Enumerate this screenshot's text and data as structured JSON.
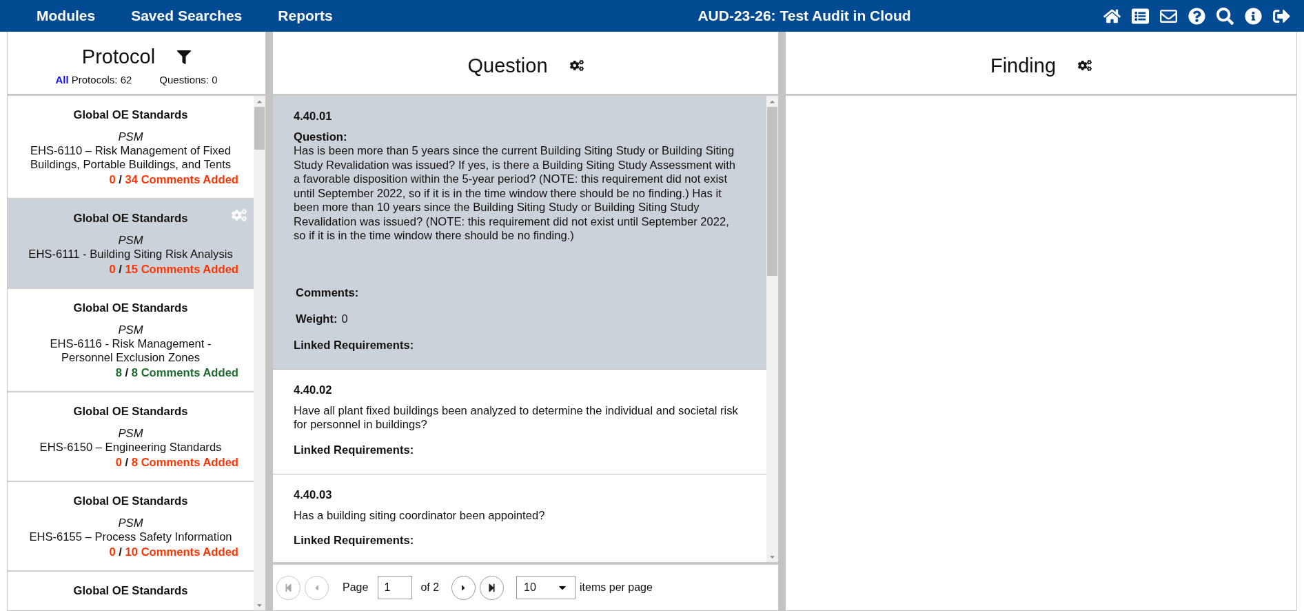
{
  "nav": {
    "menu": [
      "Modules",
      "Saved Searches",
      "Reports"
    ],
    "title": "AUD-23-26: Test Audit in Cloud"
  },
  "protocol_panel": {
    "title": "Protocol",
    "filter_all": "All",
    "protocols_count": "Protocols: 62",
    "questions_count": "Questions: 0",
    "items": [
      {
        "group": "Global OE Standards",
        "category": "PSM",
        "name": "EHS-6110 – Risk Management of Fixed Buildings, Portable Buildings, and Tents",
        "done": "0",
        "separator": "/",
        "total": "34 Comments Added",
        "color": "#ff3300",
        "selected": false
      },
      {
        "group": "Global OE Standards",
        "category": "PSM",
        "name": "EHS-6111 - Building Siting Risk Analysis",
        "done": "0",
        "separator": "/",
        "total": "15 Comments Added",
        "color": "#ff3300",
        "selected": true
      },
      {
        "group": "Global OE Standards",
        "category": "PSM",
        "name": "EHS-6116 - Risk Management - Personnel Exclusion Zones",
        "done": "8",
        "separator": "/",
        "total": "8 Comments Added",
        "color": "#1e6b2e",
        "selected": false
      },
      {
        "group": "Global OE Standards",
        "category": "PSM",
        "name": "EHS-6150 – Engineering Standards",
        "done": "0",
        "separator": "/",
        "total": "8 Comments Added",
        "color": "#ff3300",
        "selected": false
      },
      {
        "group": "Global OE Standards",
        "category": "PSM",
        "name": "EHS-6155 – Process Safety Information",
        "done": "0",
        "separator": "/",
        "total": "10 Comments Added",
        "color": "#ff3300",
        "selected": false
      },
      {
        "group": "Global OE Standards",
        "selected": false
      }
    ]
  },
  "question_panel": {
    "title": "Question",
    "questions": [
      {
        "number": "4.40.01",
        "label": "Question:",
        "text": "Has is been more than 5 years since the current Building Siting Study or Building Siting Study Revalidation was issued? If yes, is there a Building Siting Study Assessment with a favorable disposition within the 5-year period? (NOTE: this requirement did not exist until September 2022, so if it is in the time window there should be no finding.) Has it been more than 10 years since the Building Siting Study or Building Siting Study Revalidation was issued? (NOTE: this requirement did not exist until September 2022, so if it is in the time window there should be no finding.)",
        "comments_label": "Comments:",
        "weight_label": "Weight:",
        "weight_value": "0",
        "linked_label": "Linked Requirements:",
        "selected": true
      },
      {
        "number": "4.40.02",
        "text": "Have all plant fixed buildings been analyzed to determine the individual and societal risk for personnel in buildings?",
        "linked_label": "Linked Requirements:",
        "selected": false
      },
      {
        "number": "4.40.03",
        "text": "Has a building siting coordinator been appointed?",
        "linked_label": "Linked Requirements:",
        "selected": false
      }
    ],
    "pager": {
      "first_disabled": true,
      "prev_disabled": true,
      "next_disabled": false,
      "last_disabled": false,
      "page_label": "Page",
      "page_value": "1",
      "of_label": "of 2",
      "per_page_value": "10",
      "per_page_label": "items per page"
    }
  },
  "finding_panel": {
    "title": "Finding"
  }
}
